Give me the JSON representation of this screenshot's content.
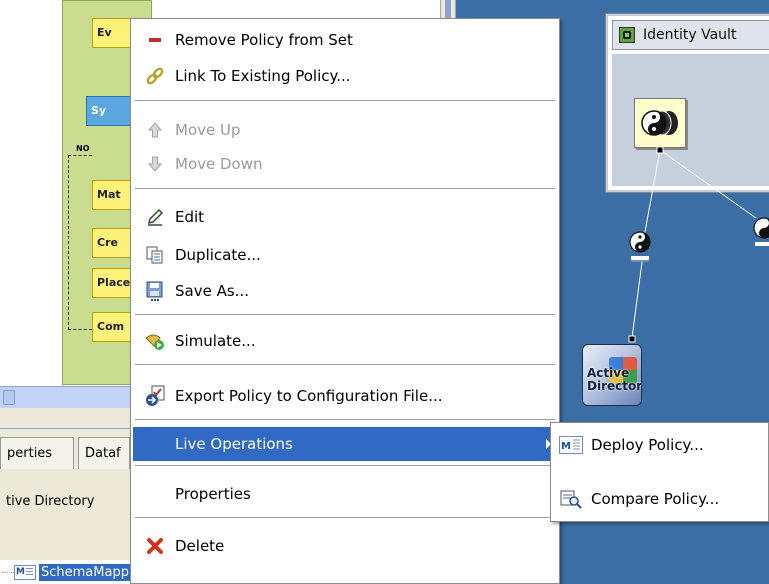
{
  "flow": {
    "no_label": "NO",
    "boxes": [
      "Ev",
      "Sy",
      "Mat",
      "Cre",
      "Place",
      "Com"
    ]
  },
  "bottom_tabs": [
    "perties",
    "Dataf"
  ],
  "field_value": "tive Directory",
  "tree": {
    "selected_item": "SchemaMapping",
    "icon_text": "M"
  },
  "vault": {
    "title": "Identity Vault"
  },
  "ad_node": {
    "label_line1": "Active",
    "label_line2": "Directory"
  },
  "context_menu": {
    "remove_policy": "Remove Policy from Set",
    "link_policy": "Link To Existing Policy...",
    "move_up": "Move Up",
    "move_down": "Move Down",
    "edit": "Edit",
    "duplicate": "Duplicate...",
    "save_as": "Save As...",
    "simulate": "Simulate...",
    "export_policy": "Export Policy to Configuration File...",
    "live_operations": "Live Operations",
    "properties": "Properties",
    "delete": "Delete"
  },
  "submenu": {
    "deploy_policy": "Deploy Policy...",
    "compare_policy": "Compare Policy..."
  },
  "colors": {
    "canvas_blue": "#3a6ea5",
    "menu_highlight": "#316ac5",
    "flow_green": "#c9dc8f",
    "flow_yellow": "#fff27a"
  }
}
